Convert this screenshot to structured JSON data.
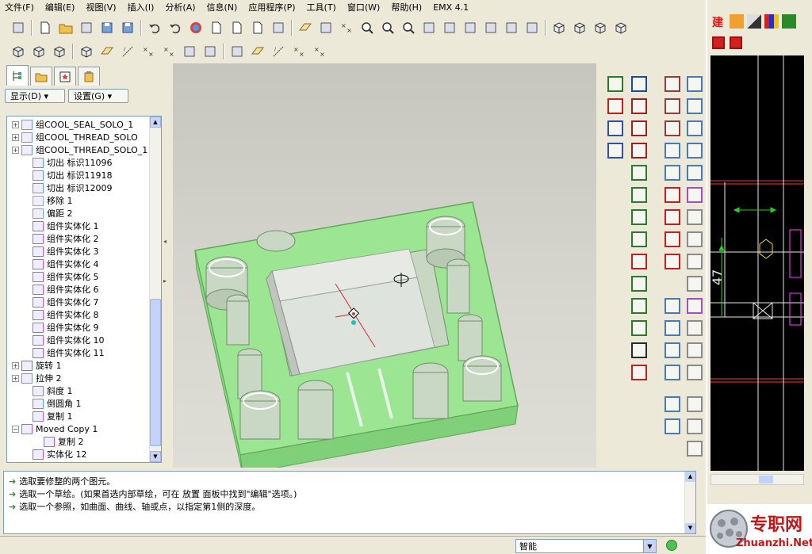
{
  "menu": [
    "文件(F)",
    "编辑(E)",
    "视图(V)",
    "插入(I)",
    "分析(A)",
    "信息(N)",
    "应用程序(P)",
    "工具(T)",
    "窗口(W)",
    "帮助(H)",
    "EMX 4.1"
  ],
  "panel": {
    "show_label": "显示(D) ▾",
    "settings_label": "设置(G) ▾"
  },
  "tree": [
    {
      "label": "组COOL_SEAL_SOLO_1",
      "indent": 0,
      "expand": "+",
      "icon": "group-icon"
    },
    {
      "label": "组COOL_THREAD_SOLO",
      "indent": 0,
      "expand": "+",
      "icon": "group-icon"
    },
    {
      "label": "组COOL_THREAD_SOLO_1",
      "indent": 0,
      "expand": "+",
      "icon": "group-icon"
    },
    {
      "label": "切出 标识11096",
      "indent": 1,
      "expand": "",
      "icon": "cut-icon"
    },
    {
      "label": "切出 标识11918",
      "indent": 1,
      "expand": "",
      "icon": "cut-icon"
    },
    {
      "label": "切出 标识12009",
      "indent": 1,
      "expand": "",
      "icon": "cut-icon"
    },
    {
      "label": "移除 1",
      "indent": 1,
      "expand": "",
      "icon": "remove-icon"
    },
    {
      "label": "偏距 2",
      "indent": 1,
      "expand": "",
      "icon": "offset-icon"
    },
    {
      "label": "组件实体化 1",
      "indent": 1,
      "expand": "",
      "icon": "solidify-icon"
    },
    {
      "label": "组件实体化 2",
      "indent": 1,
      "expand": "",
      "icon": "solidify-icon"
    },
    {
      "label": "组件实体化 3",
      "indent": 1,
      "expand": "",
      "icon": "solidify-icon"
    },
    {
      "label": "组件实体化 4",
      "indent": 1,
      "expand": "",
      "icon": "solidify-icon"
    },
    {
      "label": "组件实体化 5",
      "indent": 1,
      "expand": "",
      "icon": "solidify-icon"
    },
    {
      "label": "组件实体化 6",
      "indent": 1,
      "expand": "",
      "icon": "solidify-icon"
    },
    {
      "label": "组件实体化 7",
      "indent": 1,
      "expand": "",
      "icon": "solidify-icon"
    },
    {
      "label": "组件实体化 8",
      "indent": 1,
      "expand": "",
      "icon": "solidify-icon"
    },
    {
      "label": "组件实体化 9",
      "indent": 1,
      "expand": "",
      "icon": "solidify-icon"
    },
    {
      "label": "组件实体化 10",
      "indent": 1,
      "expand": "",
      "icon": "solidify-icon"
    },
    {
      "label": "组件实体化 11",
      "indent": 1,
      "expand": "",
      "icon": "solidify-icon"
    },
    {
      "label": "旋转 1",
      "indent": 0,
      "expand": "+",
      "icon": "revolve-icon"
    },
    {
      "label": "拉伸 2",
      "indent": 0,
      "expand": "+",
      "icon": "extrude-icon"
    },
    {
      "label": "斜度 1",
      "indent": 1,
      "expand": "",
      "icon": "draft-icon"
    },
    {
      "label": "倒圆角 1",
      "indent": 1,
      "expand": "",
      "icon": "round-icon"
    },
    {
      "label": "复制 1",
      "indent": 1,
      "expand": "",
      "icon": "copy-icon"
    },
    {
      "label": "Moved Copy 1",
      "indent": 0,
      "expand": "−",
      "icon": "moved-copy-icon"
    },
    {
      "label": "复制 2",
      "indent": 2,
      "expand": "",
      "icon": "copy-icon"
    },
    {
      "label": "实体化 12",
      "indent": 1,
      "expand": "",
      "icon": "solidify-icon"
    }
  ],
  "messages": [
    "选取要修整的两个图元。",
    "选取一个草绘。(如果首选内部草绘，可在 放置 面板中找到\"编辑\"选项。)",
    "选取一个参照，如曲面、曲线、轴或点，以指定第1侧的深度。"
  ],
  "status": {
    "filter_value": "智能"
  },
  "right_window": {
    "tool_char": "建"
  },
  "watermark": {
    "brand": "专职网",
    "domain": "Zhuanzhi.Net"
  },
  "colors": {
    "model_green": "#8fe08a",
    "message_arrow": "#1e9a1e",
    "drawing_bg": "#000000"
  }
}
